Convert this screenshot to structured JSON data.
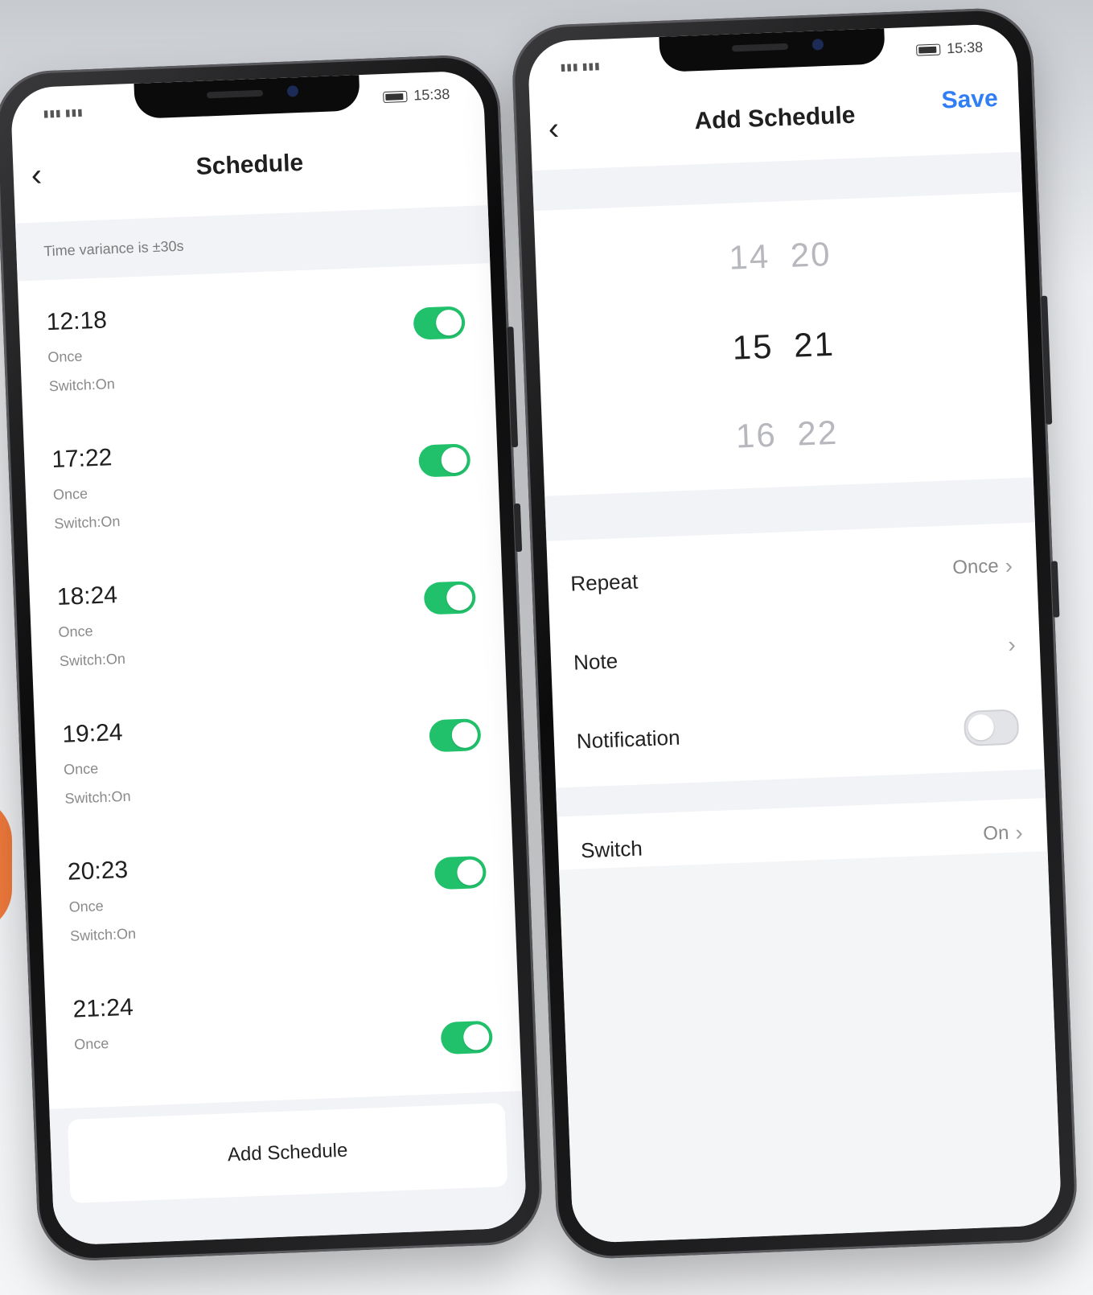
{
  "status_bar": {
    "time": "15:38"
  },
  "schedule_screen": {
    "title": "Schedule",
    "variance_text": "Time variance is ±30s",
    "items": [
      {
        "time": "12:18",
        "repeat": "Once",
        "switch": "Switch:On",
        "enabled": true
      },
      {
        "time": "17:22",
        "repeat": "Once",
        "switch": "Switch:On",
        "enabled": true
      },
      {
        "time": "18:24",
        "repeat": "Once",
        "switch": "Switch:On",
        "enabled": true
      },
      {
        "time": "19:24",
        "repeat": "Once",
        "switch": "Switch:On",
        "enabled": true
      },
      {
        "time": "20:23",
        "repeat": "Once",
        "switch": "Switch:On",
        "enabled": true
      },
      {
        "time": "21:24",
        "repeat": "Once",
        "switch": "",
        "enabled": true
      }
    ],
    "add_button": "Add Schedule"
  },
  "add_schedule_screen": {
    "title": "Add Schedule",
    "save_label": "Save",
    "picker": {
      "hours": [
        "14",
        "15",
        "16"
      ],
      "minutes": [
        "20",
        "21",
        "22"
      ],
      "selected_hour": "15",
      "selected_minute": "21"
    },
    "rows": {
      "repeat_label": "Repeat",
      "repeat_value": "Once",
      "note_label": "Note",
      "notification_label": "Notification",
      "notification_enabled": false,
      "switch_label": "Switch",
      "switch_value": "On"
    }
  },
  "colors": {
    "toggle_on": "#21c16b",
    "toggle_off": "#e3e4e8",
    "accent": "#2f7ef5"
  },
  "icons": {
    "back": "chevron-left-icon",
    "row_arrow": "chevron-right-icon"
  }
}
